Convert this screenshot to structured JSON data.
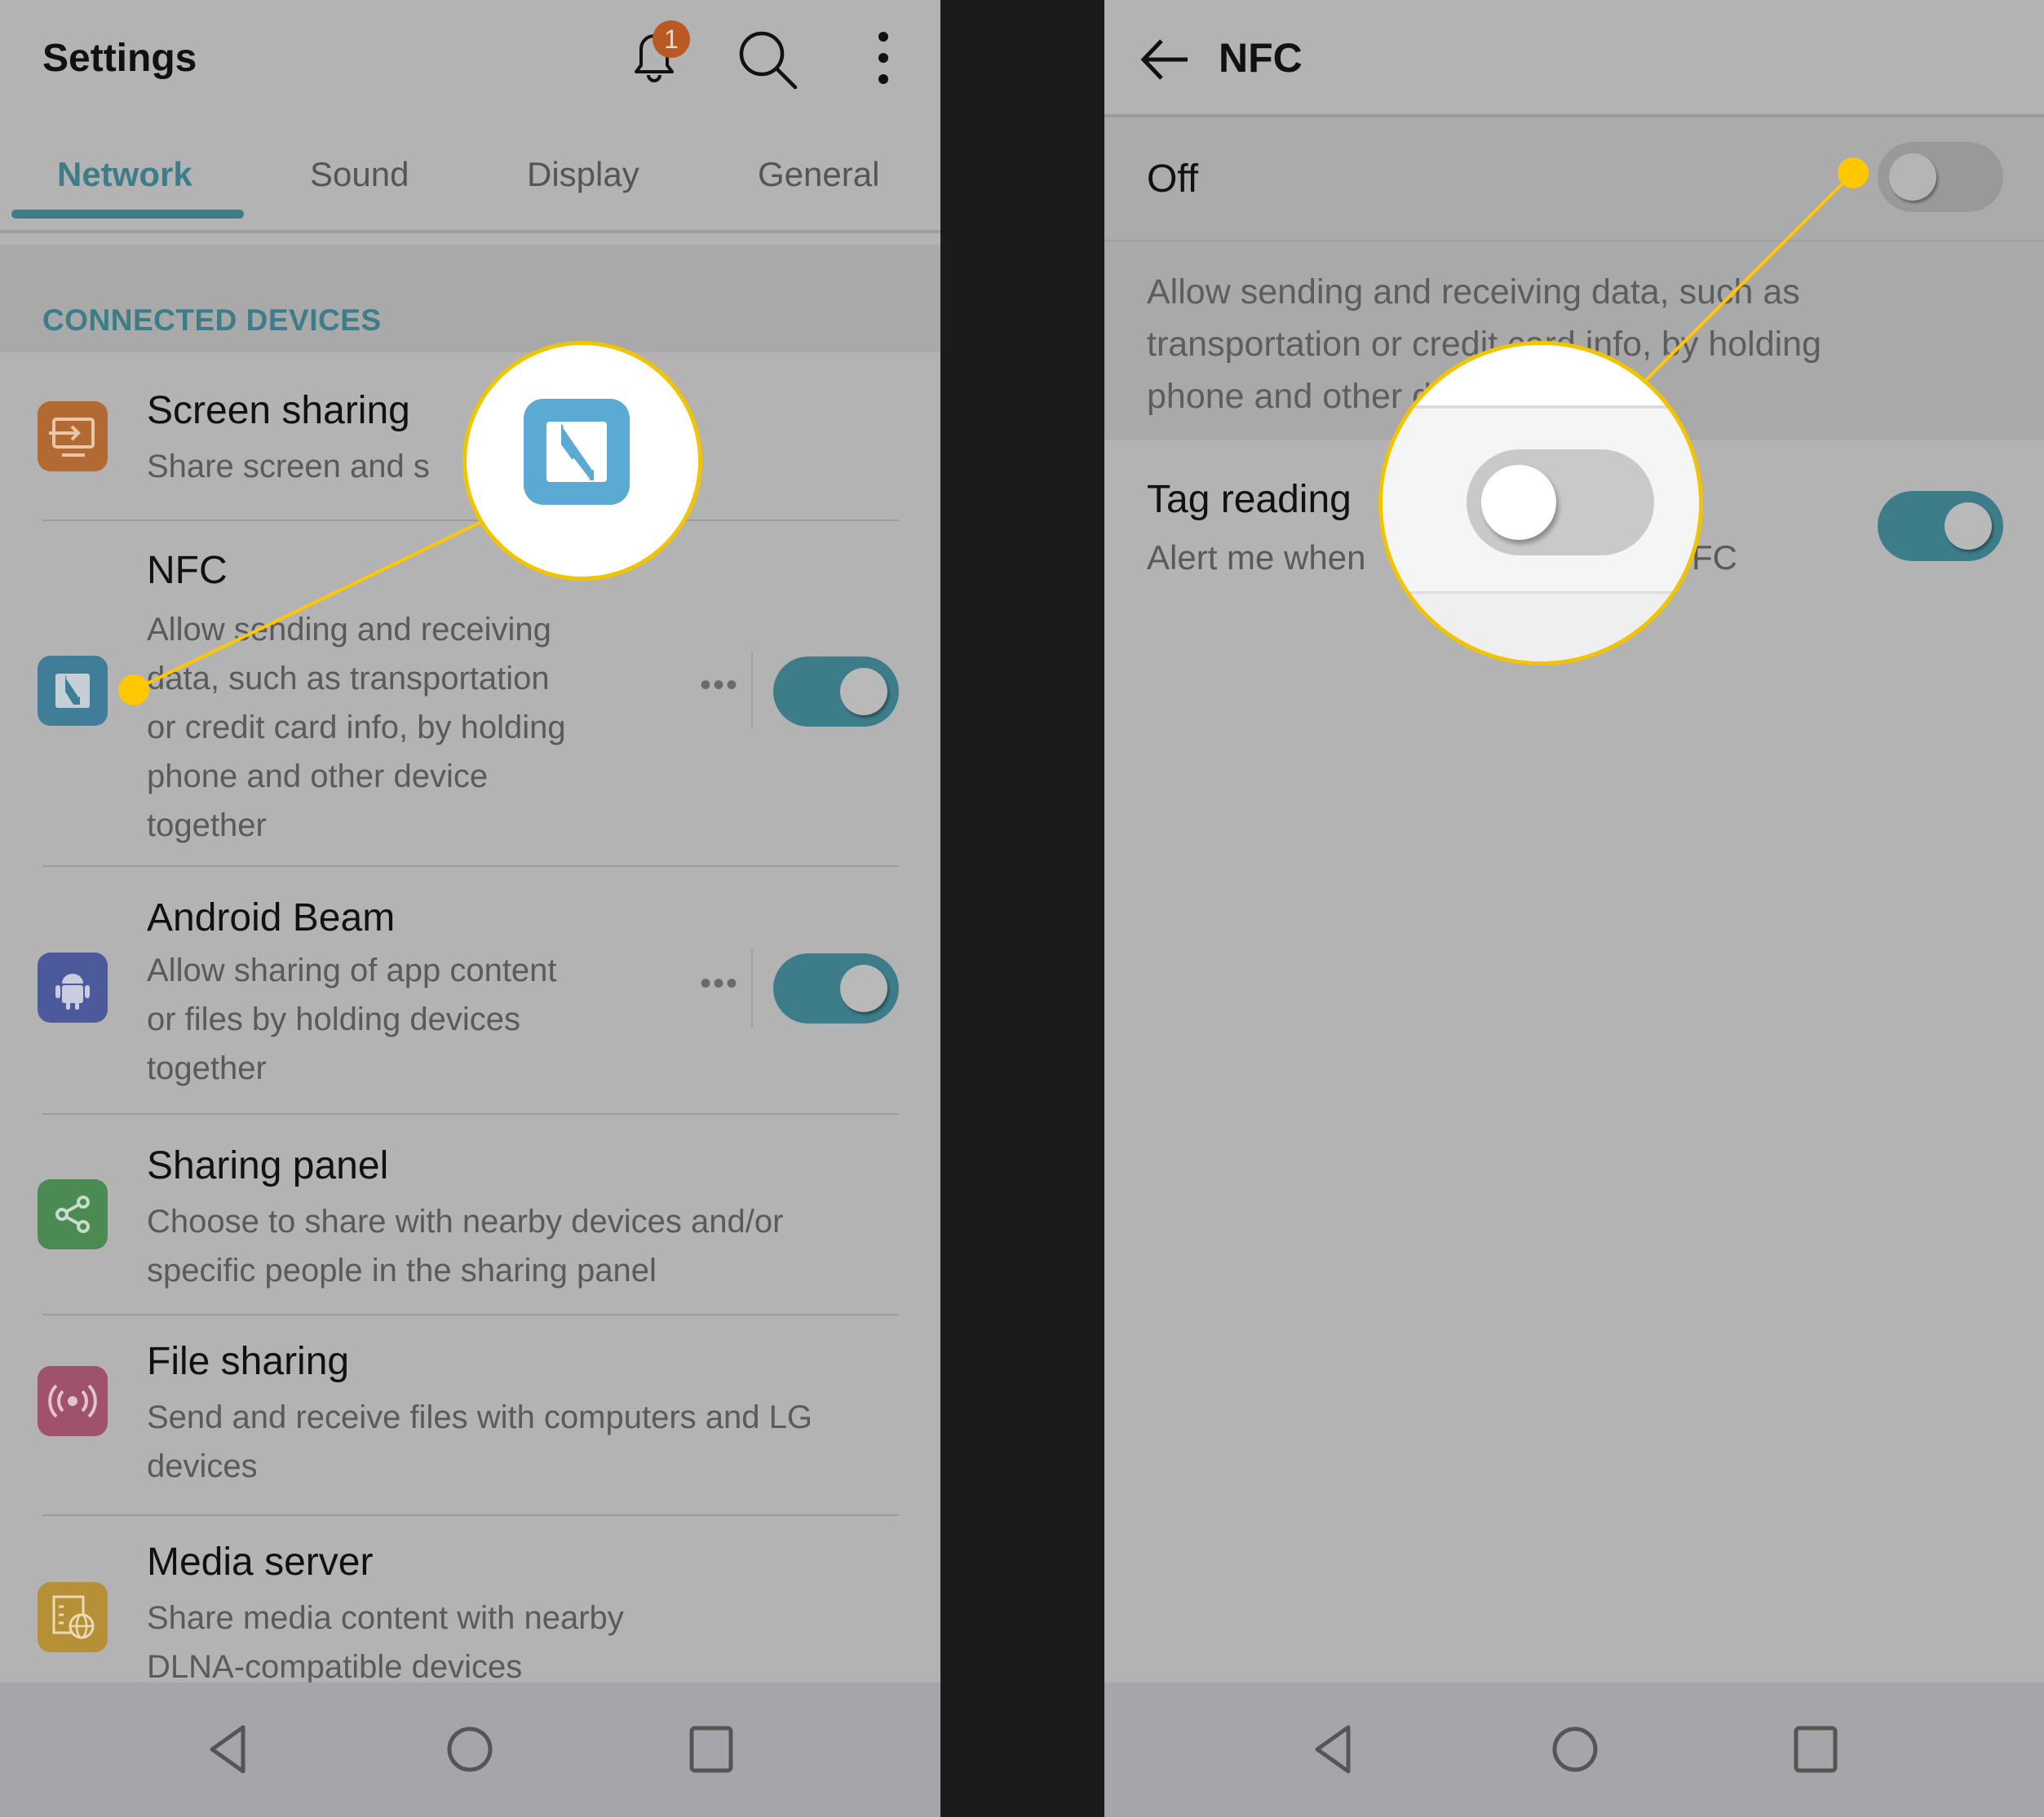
{
  "colors": {
    "accent": "#3c7d89",
    "callout": "#fdc800",
    "badge": "#b85a22",
    "background": "#b3b3b3",
    "divider": "#1b1b1b"
  },
  "left": {
    "header": {
      "title": "Settings",
      "icons": [
        "bell-icon",
        "search-icon",
        "more-vert-icon"
      ],
      "notification_count": "1"
    },
    "tabs": [
      {
        "label": "Network",
        "active": true
      },
      {
        "label": "Sound",
        "active": false
      },
      {
        "label": "Display",
        "active": false
      },
      {
        "label": "General",
        "active": false
      }
    ],
    "section_label": "CONNECTED DEVICES",
    "items": [
      {
        "title": "Screen sharing",
        "desc": [
          "Share screen and s"
        ],
        "icon": "screen-share-icon",
        "color": "#b36a32"
      },
      {
        "title": "NFC",
        "desc": [
          "Allow sending and receiving",
          "data, such as transportation",
          "or credit card info, by holding",
          "phone and other device",
          "together"
        ],
        "icon": "nfc-icon",
        "color": "#3f7d99",
        "more": "•••",
        "toggle": "on"
      },
      {
        "title": "Android Beam",
        "desc": [
          "Allow sharing of app content",
          "or files by holding devices",
          "together"
        ],
        "icon": "android-icon",
        "color": "#4c5a9b",
        "more": "•••",
        "toggle": "on"
      },
      {
        "title": "Sharing panel",
        "desc": [
          "Choose to share with nearby devices and/or",
          "specific people in the sharing panel"
        ],
        "icon": "share-icon",
        "color": "#4c8a53"
      },
      {
        "title": "File sharing",
        "desc": [
          "Send and receive files with computers and LG",
          "devices"
        ],
        "icon": "broadcast-icon",
        "color": "#a0526a"
      },
      {
        "title": "Media server",
        "desc": [
          "Share media content with nearby",
          "DLNA-compatible devices"
        ],
        "icon": "media-server-icon",
        "color": "#b59037"
      }
    ],
    "magnifier": {
      "content": "nfc-icon",
      "color": "#5aaad3"
    }
  },
  "right": {
    "header": {
      "title": "NFC",
      "back_icon": "arrow-left-icon"
    },
    "master_toggle": {
      "label": "Off",
      "state": "off"
    },
    "description": [
      "Allow sending and receiving data, such as",
      "transportation or credit card info, by holding",
      "phone and other device together."
    ],
    "tag_reading": {
      "title": "Tag reading",
      "desc_visible_start": "Alert me when",
      "desc_visible_end": "FC",
      "toggle": "on"
    },
    "magnifier": {
      "content": "toggle-off",
      "state": "off"
    }
  },
  "navbar": {
    "buttons": [
      "back-icon",
      "home-icon",
      "recents-icon"
    ]
  }
}
